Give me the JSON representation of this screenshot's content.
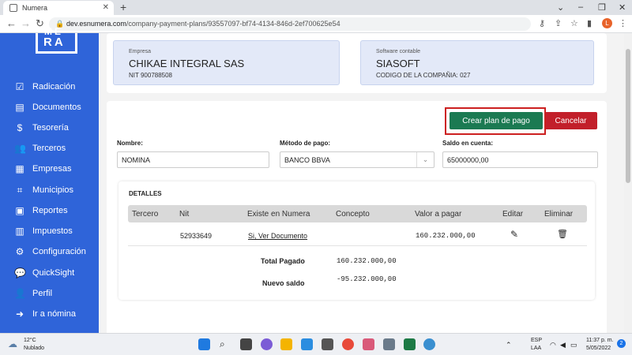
{
  "browser": {
    "tab_title": "Numera",
    "tab_close": "✕",
    "new_tab": "+",
    "url_host": "dev.esnumera.com",
    "url_path": "/company-payment-plans/93557097-bf74-4134-846d-2ef700625e54",
    "profile_initial": "L",
    "win_chevron": "⌄",
    "win_minimize": "–",
    "win_maximize": "❐",
    "win_close": "✕"
  },
  "sidebar": {
    "logo_top": "ME",
    "logo_bottom": "RA",
    "items": [
      {
        "label": "Radicación",
        "icon": "check-square-icon"
      },
      {
        "label": "Documentos",
        "icon": "folder-icon"
      },
      {
        "label": "Tesorería",
        "icon": "money-bag-icon"
      },
      {
        "label": "Terceros",
        "icon": "users-icon"
      },
      {
        "label": "Empresas",
        "icon": "briefcase-icon"
      },
      {
        "label": "Municipios",
        "icon": "map-icon"
      },
      {
        "label": "Reportes",
        "icon": "report-icon"
      },
      {
        "label": "Impuestos",
        "icon": "calculator-icon"
      },
      {
        "label": "Configuración",
        "icon": "gear-icon"
      },
      {
        "label": "QuickSight",
        "icon": "chat-icon"
      },
      {
        "label": "Perfil",
        "icon": "user-icon"
      },
      {
        "label": "Ir a nómina",
        "icon": "logout-icon"
      }
    ]
  },
  "company": {
    "label": "Empresa",
    "name": "CHIKAE INTEGRAL SAS",
    "nit": "NIT 900788508"
  },
  "software": {
    "label": "Software contable",
    "name": "SIASOFT",
    "code": "CODIGO DE LA COMPAÑIA: 027"
  },
  "actions": {
    "create_label": "Crear plan de pago",
    "cancel_label": "Cancelar"
  },
  "form": {
    "name_label": "Nombre:",
    "name_value": "NOMINA",
    "method_label": "Método de pago:",
    "method_value": "BANCO BBVA",
    "balance_label": "Saldo en cuenta:",
    "balance_value": "65000000,00"
  },
  "details": {
    "title": "DETALLES",
    "columns": [
      "Tercero",
      "Nit",
      "Existe en Numera",
      "Concepto",
      "Valor a pagar",
      "Editar",
      "Eliminar"
    ],
    "row": {
      "tercero": "",
      "nit": "52933649",
      "existe": "Si, Ver Documento",
      "concepto": "",
      "valor": "160.232.000,00"
    },
    "total_label": "Total Pagado",
    "total_value": "160.232.000,00",
    "saldo_label": "Nuevo saldo",
    "saldo_value": "-95.232.000,00"
  },
  "taskbar": {
    "temp": "12°C",
    "weather": "Nublado",
    "lang": "ESP",
    "lang2": "LAA",
    "time": "11:37 p. m.",
    "date": "5/05/2022",
    "notif_count": "2"
  }
}
